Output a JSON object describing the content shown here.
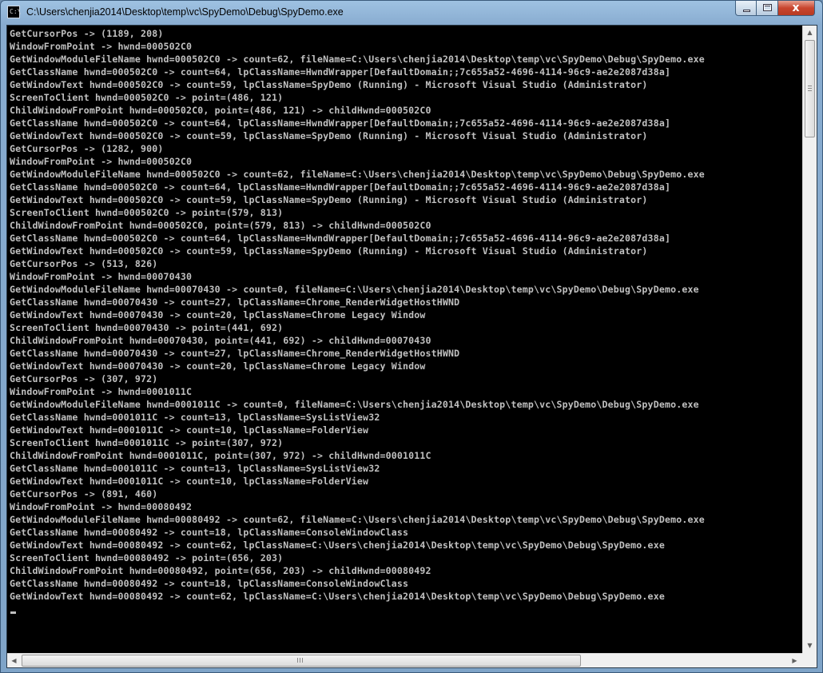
{
  "window": {
    "title": "C:\\Users\\chenjia2014\\Desktop\\temp\\vc\\SpyDemo\\Debug\\SpyDemo.exe",
    "icon_text": "C:\\",
    "close_label": "x"
  },
  "console": {
    "lines": [
      "GetCursorPos -> (1189, 208)",
      "WindowFromPoint -> hwnd=000502C0",
      "GetWindowModuleFileName hwnd=000502C0 -> count=62, fileName=C:\\Users\\chenjia2014\\Desktop\\temp\\vc\\SpyDemo\\Debug\\SpyDemo.exe",
      "GetClassName hwnd=000502C0 -> count=64, lpClassName=HwndWrapper[DefaultDomain;;7c655a52-4696-4114-96c9-ae2e2087d38a]",
      "GetWindowText hwnd=000502C0 -> count=59, lpClassName=SpyDemo (Running) - Microsoft Visual Studio (Administrator)",
      "ScreenToClient hwnd=000502C0 -> point=(486, 121)",
      "ChildWindowFromPoint hwnd=000502C0, point=(486, 121) -> childHwnd=000502C0",
      "GetClassName hwnd=000502C0 -> count=64, lpClassName=HwndWrapper[DefaultDomain;;7c655a52-4696-4114-96c9-ae2e2087d38a]",
      "GetWindowText hwnd=000502C0 -> count=59, lpClassName=SpyDemo (Running) - Microsoft Visual Studio (Administrator)",
      "GetCursorPos -> (1282, 900)",
      "WindowFromPoint -> hwnd=000502C0",
      "GetWindowModuleFileName hwnd=000502C0 -> count=62, fileName=C:\\Users\\chenjia2014\\Desktop\\temp\\vc\\SpyDemo\\Debug\\SpyDemo.exe",
      "GetClassName hwnd=000502C0 -> count=64, lpClassName=HwndWrapper[DefaultDomain;;7c655a52-4696-4114-96c9-ae2e2087d38a]",
      "GetWindowText hwnd=000502C0 -> count=59, lpClassName=SpyDemo (Running) - Microsoft Visual Studio (Administrator)",
      "ScreenToClient hwnd=000502C0 -> point=(579, 813)",
      "ChildWindowFromPoint hwnd=000502C0, point=(579, 813) -> childHwnd=000502C0",
      "GetClassName hwnd=000502C0 -> count=64, lpClassName=HwndWrapper[DefaultDomain;;7c655a52-4696-4114-96c9-ae2e2087d38a]",
      "GetWindowText hwnd=000502C0 -> count=59, lpClassName=SpyDemo (Running) - Microsoft Visual Studio (Administrator)",
      "GetCursorPos -> (513, 826)",
      "WindowFromPoint -> hwnd=00070430",
      "GetWindowModuleFileName hwnd=00070430 -> count=0, fileName=C:\\Users\\chenjia2014\\Desktop\\temp\\vc\\SpyDemo\\Debug\\SpyDemo.exe",
      "GetClassName hwnd=00070430 -> count=27, lpClassName=Chrome_RenderWidgetHostHWND",
      "GetWindowText hwnd=00070430 -> count=20, lpClassName=Chrome Legacy Window",
      "ScreenToClient hwnd=00070430 -> point=(441, 692)",
      "ChildWindowFromPoint hwnd=00070430, point=(441, 692) -> childHwnd=00070430",
      "GetClassName hwnd=00070430 -> count=27, lpClassName=Chrome_RenderWidgetHostHWND",
      "GetWindowText hwnd=00070430 -> count=20, lpClassName=Chrome Legacy Window",
      "GetCursorPos -> (307, 972)",
      "WindowFromPoint -> hwnd=0001011C",
      "GetWindowModuleFileName hwnd=0001011C -> count=0, fileName=C:\\Users\\chenjia2014\\Desktop\\temp\\vc\\SpyDemo\\Debug\\SpyDemo.exe",
      "GetClassName hwnd=0001011C -> count=13, lpClassName=SysListView32",
      "GetWindowText hwnd=0001011C -> count=10, lpClassName=FolderView",
      "ScreenToClient hwnd=0001011C -> point=(307, 972)",
      "ChildWindowFromPoint hwnd=0001011C, point=(307, 972) -> childHwnd=0001011C",
      "GetClassName hwnd=0001011C -> count=13, lpClassName=SysListView32",
      "GetWindowText hwnd=0001011C -> count=10, lpClassName=FolderView",
      "GetCursorPos -> (891, 460)",
      "WindowFromPoint -> hwnd=00080492",
      "GetWindowModuleFileName hwnd=00080492 -> count=62, fileName=C:\\Users\\chenjia2014\\Desktop\\temp\\vc\\SpyDemo\\Debug\\SpyDemo.exe",
      "GetClassName hwnd=00080492 -> count=18, lpClassName=ConsoleWindowClass",
      "GetWindowText hwnd=00080492 -> count=62, lpClassName=C:\\Users\\chenjia2014\\Desktop\\temp\\vc\\SpyDemo\\Debug\\SpyDemo.exe",
      "ScreenToClient hwnd=00080492 -> point=(656, 203)",
      "ChildWindowFromPoint hwnd=00080492, point=(656, 203) -> childHwnd=00080492",
      "GetClassName hwnd=00080492 -> count=18, lpClassName=ConsoleWindowClass",
      "GetWindowText hwnd=00080492 -> count=62, lpClassName=C:\\Users\\chenjia2014\\Desktop\\temp\\vc\\SpyDemo\\Debug\\SpyDemo.exe"
    ]
  },
  "scrollbars": {
    "up_arrow": "▲",
    "down_arrow": "▼",
    "left_arrow": "◀",
    "right_arrow": "▶"
  },
  "colors": {
    "console_bg": "#000000",
    "console_text": "#c0c0c0",
    "titlebar": "#9fc2e2"
  }
}
